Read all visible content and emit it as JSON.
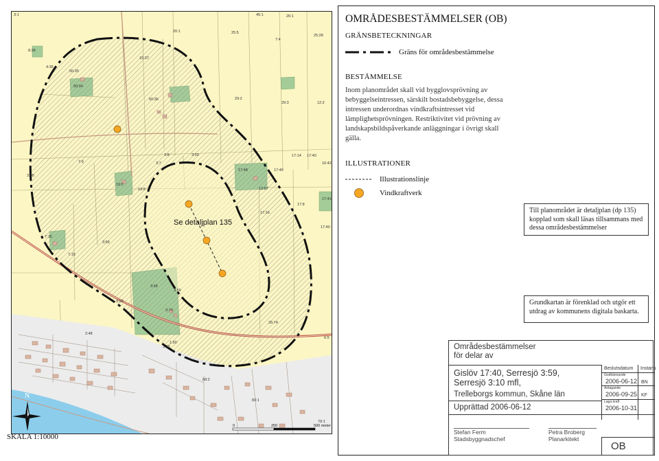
{
  "map": {
    "detail_label": "Se detaljplan 135",
    "north_label": "N",
    "scale_text": "SKALA 1:10000",
    "scalebar_labels": [
      "0",
      "250",
      "500 meter"
    ],
    "parcel_labels": [
      "3:1",
      "20:1",
      "25:5",
      "45:1",
      "26:1",
      "25:28",
      "7:4",
      "8:28",
      "4:35",
      "50:35",
      "10:37",
      "50:34",
      "50:36",
      "29:2",
      "29:3",
      "12:2",
      "3:8",
      "3:59",
      "17:14",
      "17:40",
      "7:9",
      "3:7",
      "17:48",
      "17:46",
      "16:42",
      "3:95",
      "19:2",
      "13:9",
      "12:57",
      "17:41",
      "17:8",
      "17:16",
      "17:40",
      "7:16",
      "3:59",
      "7:15",
      "3:68",
      "3:59",
      "3:70",
      "3:59",
      "26:74",
      "2:48",
      "1:50",
      "3:45",
      "68:2",
      "83:1",
      "79:1",
      "6:5"
    ],
    "colors": {
      "field": "#fcf6c4",
      "forest": "#a4cc98",
      "water": "#8ccdec",
      "urban": "#ececec",
      "road": "#c05a3c",
      "hatch": "#9a9a9a",
      "turbine": "#f5a623"
    }
  },
  "panel": {
    "title": "OMRÅDESBESTÄMMELSER (OB)",
    "gransbeteckningar": "GRÄNSBETECKNINGAR",
    "boundary_legend": "Gräns för områdesbestämmelse",
    "bestammelse_heading": "BESTÄMMELSE",
    "bestammelse_text": "Inom planområdet skall vid bygglovsprövning av bebyggelseintressen, särskilt bostadsbebyggelse, dessa intressen underordnas vindkraftsintresset vid lämplighetsprövningen. Restriktivitet vid prövning av landskapsbildspåverkande anläggningar i övrigt skall gälla.",
    "illustrationer_heading": "ILLUSTRATIONER",
    "illustrationslinje": "Illustrationslinje",
    "vindkraftverk": "Vindkraftverk",
    "note1": "Till planområdet är detaljplan (dp 135) kopplad som skall läsas tillsammans med dessa områdesbestämmelser",
    "note2": "Grundkartan är förenklad och utgör ett utdrag av kommunens digitala baskarta."
  },
  "titleblock": {
    "line1": "Områdesbestämmelser",
    "line2": "för delar av",
    "place1": "Gislöv 17:40, Serresjö 3:59,",
    "place2": "Serresjö 3:10 mfl,",
    "municipality": "Trelleborgs kommun, Skåne län",
    "upprattad": "Upprättad 2006-06-12",
    "col_beslut": "Beslutsdatum",
    "col_instans": "Instans",
    "lbl_godkannande": "Godkännande",
    "date_godkannande": "2006-06-12",
    "inst_godkannande": "BN",
    "lbl_antagande": "Antagande",
    "date_antagande": "2006-09-25",
    "inst_antagande": "KF",
    "lbl_lagakraft": "Laga kraft",
    "date_lagakraft": "2006-10-31",
    "sig1_name": "Stefan Ferm",
    "sig1_title": "Stadsbyggnadschef",
    "sig2_name": "Petra Broberg",
    "sig2_title": "Planarkitekt",
    "code": "OB"
  }
}
